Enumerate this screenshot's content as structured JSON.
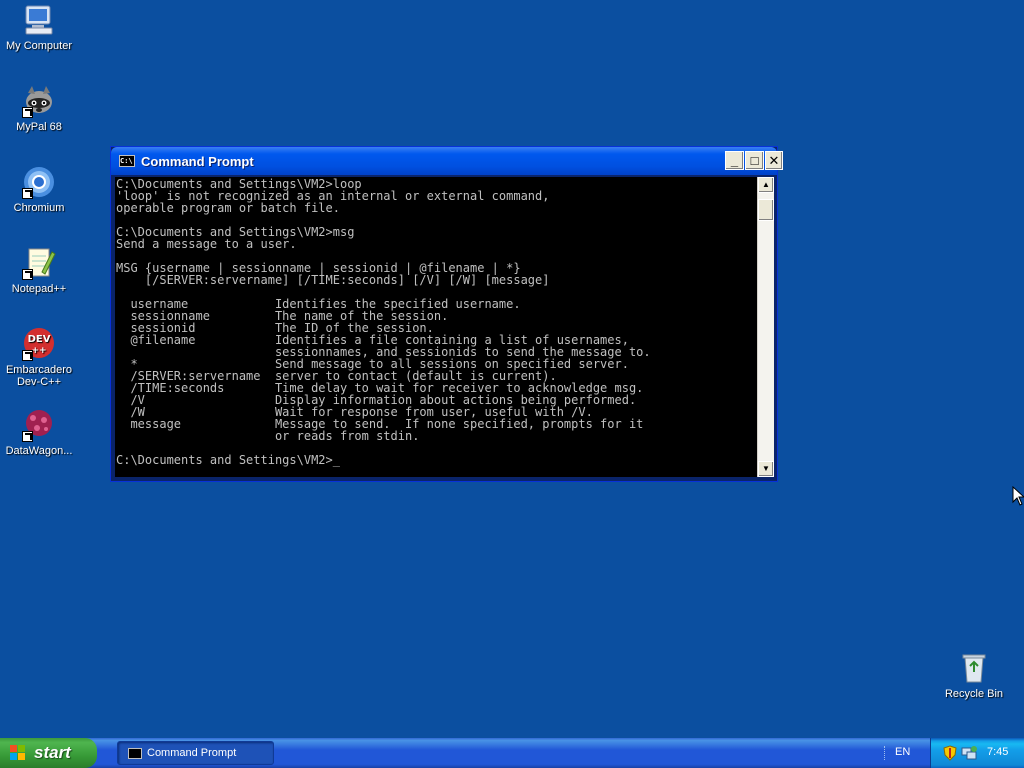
{
  "desktop": {
    "icons": [
      {
        "label": "My Computer"
      },
      {
        "label": "MyPal 68"
      },
      {
        "label": "Chromium"
      },
      {
        "label": "Notepad++"
      },
      {
        "label": "Embarcadero Dev-C++"
      },
      {
        "label": "DataWagon..."
      },
      {
        "label": "Recycle Bin"
      }
    ]
  },
  "window": {
    "title": "Command Prompt",
    "icon_text": "C:\\",
    "buttons": {
      "minimize": "_",
      "maximize": "□",
      "close": "✕"
    },
    "console_text": "C:\\Documents and Settings\\VM2>loop\n'loop' is not recognized as an internal or external command,\noperable program or batch file.\n\nC:\\Documents and Settings\\VM2>msg\nSend a message to a user.\n\nMSG {username | sessionname | sessionid | @filename | *}\n    [/SERVER:servername] [/TIME:seconds] [/V] [/W] [message]\n\n  username            Identifies the specified username.\n  sessionname         The name of the session.\n  sessionid           The ID of the session.\n  @filename           Identifies a file containing a list of usernames,\n                      sessionnames, and sessionids to send the message to.\n  *                   Send message to all sessions on specified server.\n  /SERVER:servername  server to contact (default is current).\n  /TIME:seconds       Time delay to wait for receiver to acknowledge msg.\n  /V                  Display information about actions being performed.\n  /W                  Wait for response from user, useful with /V.\n  message             Message to send.  If none specified, prompts for it\n                      or reads from stdin.\n\nC:\\Documents and Settings\\VM2>_"
  },
  "taskbar": {
    "start_label": "start",
    "task_label": "Command Prompt",
    "language": "EN",
    "clock": "7:45"
  },
  "colors": {
    "desktop_bg": "#0b4fa0",
    "console_bg": "#000000",
    "console_fg": "#c0c0c0",
    "titlebar": "#0058ee",
    "start_green": "#3c9a3c"
  }
}
